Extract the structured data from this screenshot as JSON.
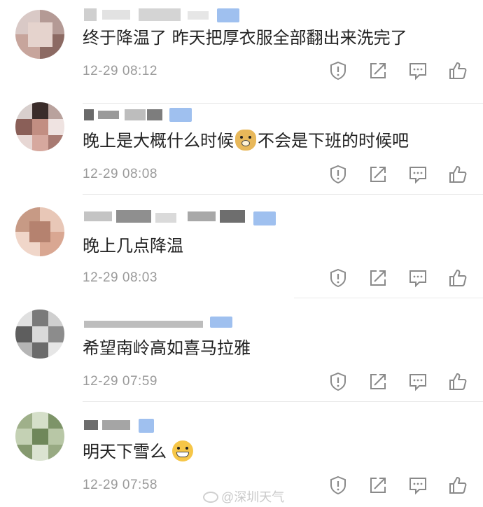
{
  "comments": [
    {
      "text": "终于降温了 昨天把厚衣服全部翻出来洗完了",
      "time": "12-29 08:12"
    },
    {
      "text_before": "晚上是大概什么时候",
      "text_after": "不会是下班的时候吧",
      "time": "12-29 08:08"
    },
    {
      "text": "晚上几点降温",
      "time": "12-29 08:03"
    },
    {
      "text": "希望南岭高如喜马拉雅",
      "time": "12-29 07:59"
    },
    {
      "text": "明天下雪么",
      "time": "12-29 07:58"
    }
  ],
  "watermark": "@深圳天气",
  "colors": {
    "time_gray": "#9a9a9a",
    "text": "#222222",
    "icon_gray": "#8a8a8a",
    "vip_blue": "#9fc0ef"
  },
  "icons": [
    "report-icon",
    "forward-icon",
    "reply-icon",
    "like-icon",
    "doge-emoji",
    "grin-emoji"
  ]
}
